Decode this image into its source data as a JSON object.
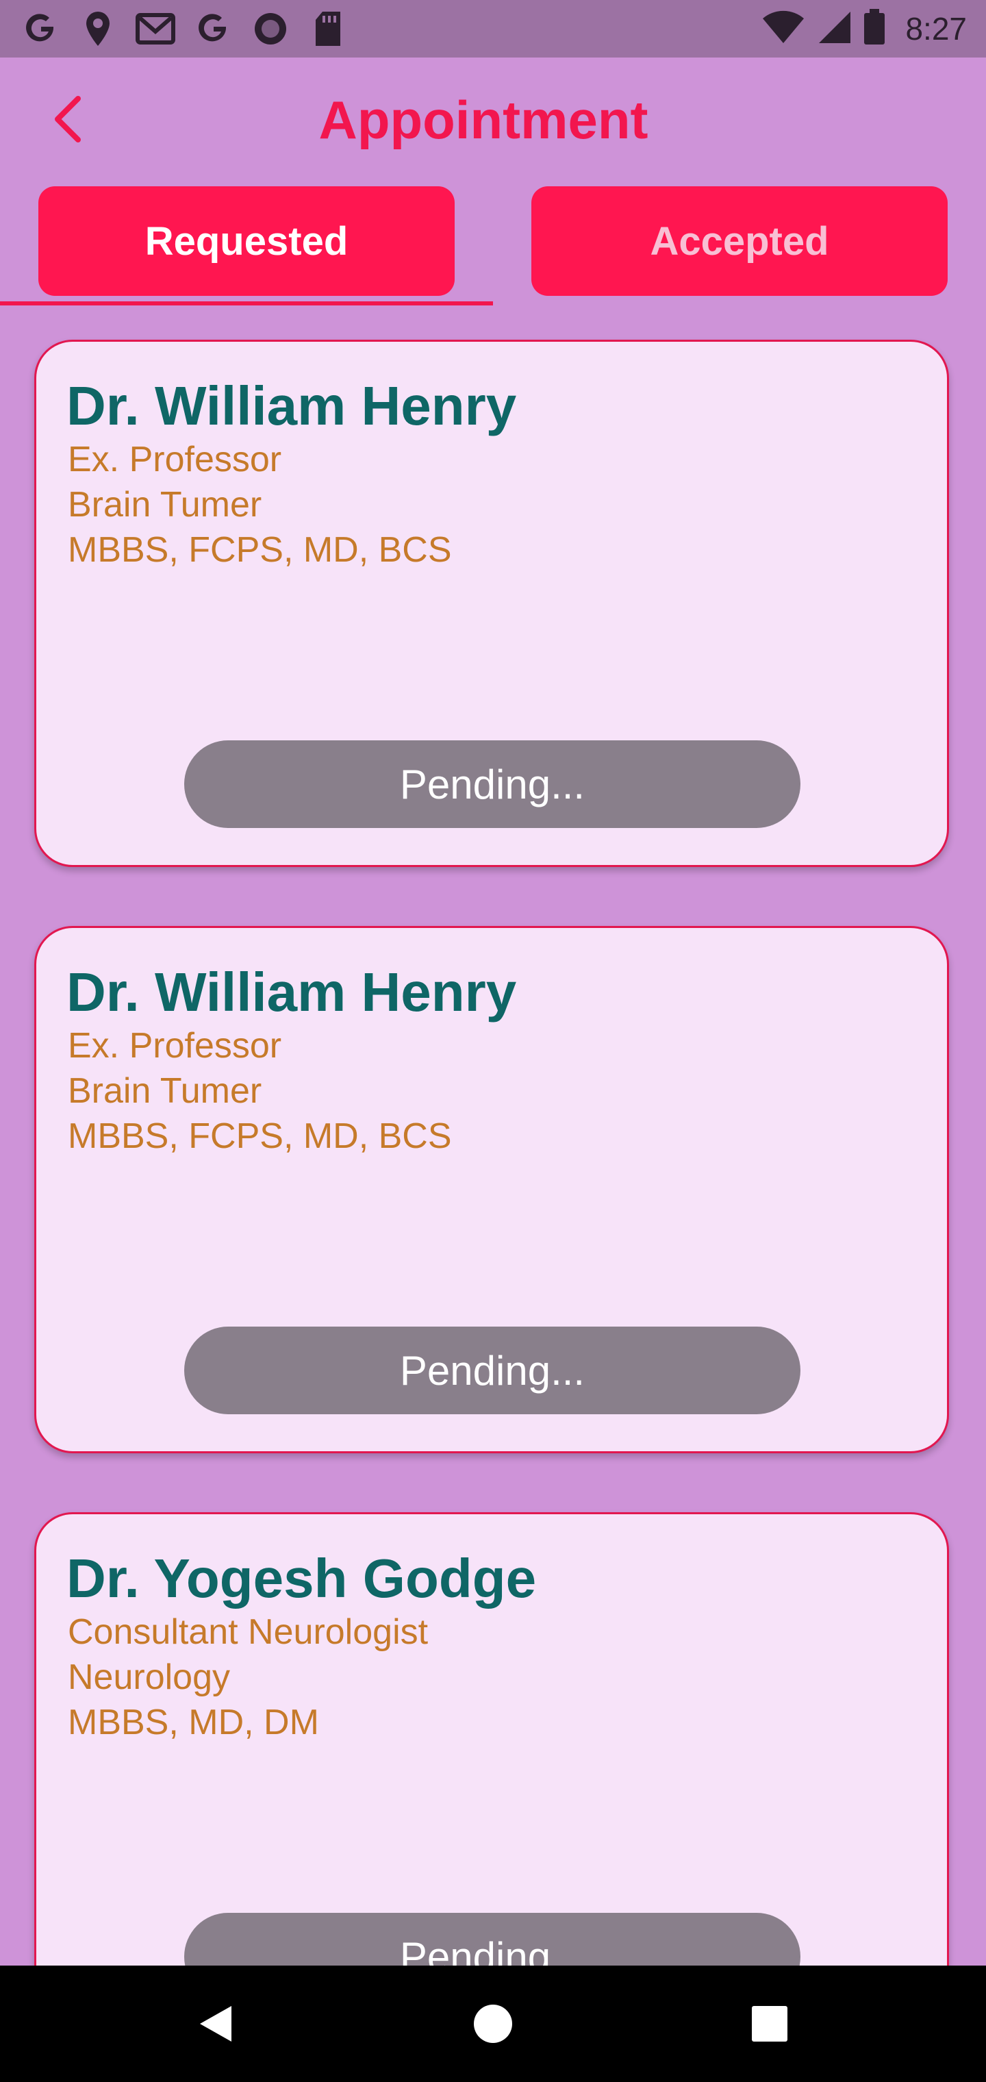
{
  "status_bar": {
    "time": "8:27",
    "left_icons": [
      "google-g-icon",
      "location-pin-icon",
      "gmail-icon",
      "google-g-icon",
      "record-circle-icon",
      "sd-card-icon"
    ],
    "right_icons": [
      "wifi-icon",
      "cell-signal-icon",
      "battery-icon"
    ]
  },
  "app_bar": {
    "title": "Appointment",
    "back_icon": "chevron-left-icon",
    "accent_color": "#F2164E"
  },
  "tabs": [
    {
      "label": "Requested",
      "selected": true
    },
    {
      "label": "Accepted",
      "selected": false
    }
  ],
  "appointments": [
    {
      "name": "Dr. William Henry",
      "title": "Ex. Professor",
      "specialty": "Brain Tumer",
      "degrees": "MBBS, FCPS, MD, BCS",
      "status": "Pending..."
    },
    {
      "name": "Dr. William Henry",
      "title": "Ex. Professor",
      "specialty": "Brain Tumer",
      "degrees": "MBBS, FCPS, MD, BCS",
      "status": "Pending..."
    },
    {
      "name": "Dr. Yogesh Godge",
      "title": "Consultant Neurologist",
      "specialty": "Neurology",
      "degrees": "MBBS, MD, DM",
      "status": "Pending..."
    }
  ],
  "nav_bar": {
    "icons": [
      "back-triangle-icon",
      "home-circle-icon",
      "recents-square-icon"
    ]
  },
  "colors": {
    "background": "#CE93D8",
    "status_bar": "#9C72A3",
    "tab": "#FF1650",
    "card": "#F7E3F9",
    "card_border": "#E21750",
    "doctor_name": "#0F6666",
    "doctor_detail": "#C67A2A",
    "pending_button": "#897F8B"
  }
}
